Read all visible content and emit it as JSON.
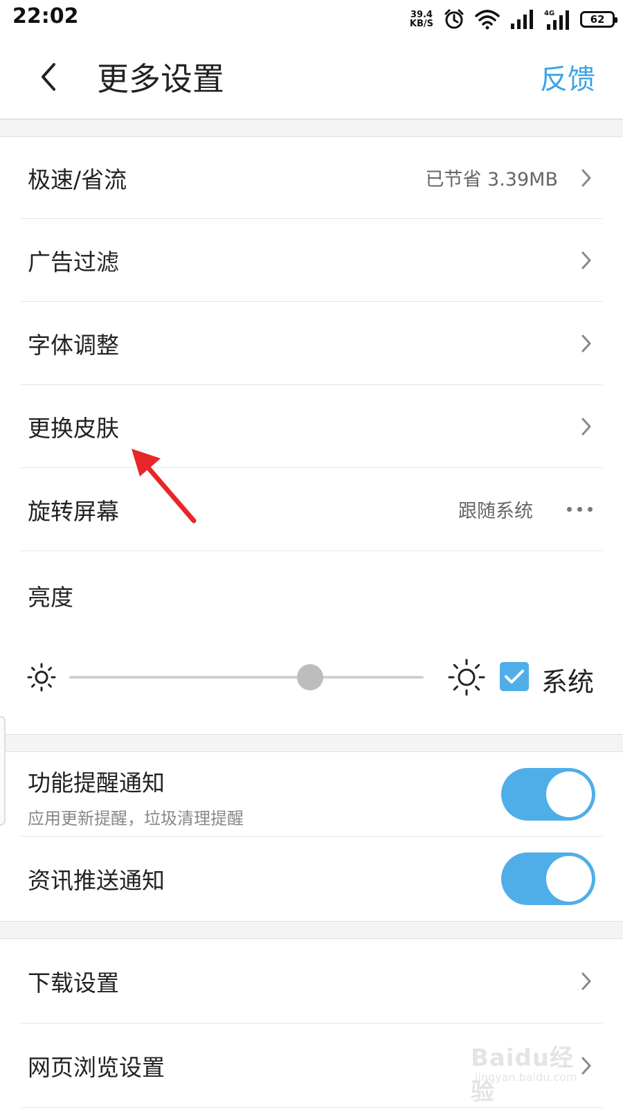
{
  "status_bar": {
    "time": "22:02",
    "net_speed_value": "39.4",
    "net_speed_unit": "KB/S",
    "network_type": "4G",
    "battery": "62"
  },
  "header": {
    "title": "更多设置",
    "feedback_label": "反馈"
  },
  "settings": {
    "speed_mode": {
      "label": "极速/省流",
      "value": "已节省 3.39MB"
    },
    "ad_filter": {
      "label": "广告过滤"
    },
    "font_adjust": {
      "label": "字体调整"
    },
    "change_skin": {
      "label": "更换皮肤"
    },
    "rotate_screen": {
      "label": "旋转屏幕",
      "value": "跟随系统"
    },
    "brightness": {
      "label": "亮度",
      "level": 0.68,
      "system_label": "系统",
      "system_checked": true
    }
  },
  "notifications": {
    "feature_reminder": {
      "label": "功能提醒通知",
      "sub": "应用更新提醒，垃圾清理提醒",
      "enabled": true
    },
    "news_push": {
      "label": "资讯推送通知",
      "enabled": true
    }
  },
  "more_settings": {
    "download": {
      "label": "下载设置"
    },
    "web_browse": {
      "label": "网页浏览设置"
    }
  },
  "watermark": {
    "main": "Baidu经验",
    "sub": "jingyan.baidu.com"
  },
  "colors": {
    "accent": "#4faee8",
    "feedback": "#3aa3e6",
    "arrow": "#e8262a"
  }
}
